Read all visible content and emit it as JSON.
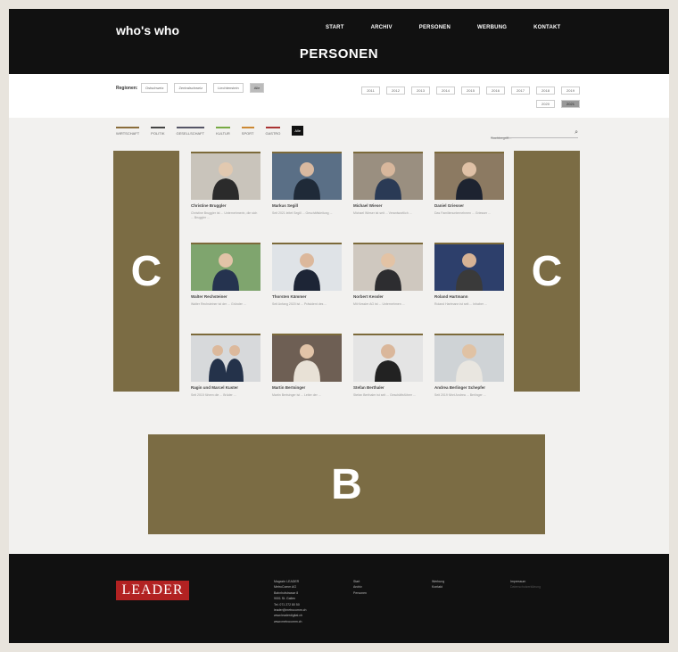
{
  "header": {
    "logo": "who's who",
    "nav": [
      "START",
      "ARCHIV",
      "PERSONEN",
      "WERBUNG",
      "KONTAKT"
    ],
    "page_title": "PERSONEN"
  },
  "filter": {
    "regions_label": "Regionen:",
    "regions": [
      "Ostschweiz",
      "Zentralschweiz",
      "Liechtenstein",
      "Alle"
    ],
    "years": [
      "2011",
      "2012",
      "2013",
      "2014",
      "2015",
      "2016",
      "2017",
      "2018",
      "2019",
      "2020",
      "2021"
    ]
  },
  "categories": [
    "WIRTSCHAFT",
    "POLITIK",
    "GESELLSCHAFT",
    "KULTUR",
    "SPORT",
    "GASTRO",
    "Alle"
  ],
  "search": {
    "placeholder": "Suchbegriff..."
  },
  "people": [
    {
      "name": "Christine Bruggler",
      "desc": "Christine Bruggler ist ... Unternehmerin, die sich ... Bruggler ..."
    },
    {
      "name": "Markus Segill",
      "desc": "Seit 2021 leitet Segill ... Geschäftsleitung ..."
    },
    {
      "name": "Michael Wieser",
      "desc": "Michael Wieser ist seit ... Verantwortlich ..."
    },
    {
      "name": "Daniel Griesser",
      "desc": "Das Familienunternehmen ... Griesser ..."
    },
    {
      "name": "Walter Rechsteiner",
      "desc": "Walter Rechsteiner ist der ... Gründer ..."
    },
    {
      "name": "Thorsten Kämmer",
      "desc": "Seit Anfang 2020 ist ... Präsident des ..."
    },
    {
      "name": "Norbert Kessler",
      "desc": "Mit Kessler AG ist ... Unternehmen ..."
    },
    {
      "name": "Roland Hartmann",
      "desc": "Roland Hartmann ist seit ... Inhaber ..."
    },
    {
      "name": "Ragin und Marcel Kuster",
      "desc": "Seit 2015 führen die ... Brüder ..."
    },
    {
      "name": "Martin Bertsinger",
      "desc": "Martin Bertsinger ist ... Leiter der ..."
    },
    {
      "name": "Stefan Berthaler",
      "desc": "Stefan Berthaler ist seit ... Geschäftsführer ..."
    },
    {
      "name": "Andrea Berlinger Schepfer",
      "desc": "Seit 2019 führt Andrea ... Berlinger ..."
    }
  ],
  "ads": {
    "left": "C",
    "right": "C",
    "bottom": "B"
  },
  "footer": {
    "logo": "LEADER",
    "col_a": [
      "Magazin LEADER",
      "MetroComm AG",
      "Bahnhofstrasse 8",
      "9001 St. Gallen",
      "Tel. 071 272 80 50",
      "leader@metrocomm.ch",
      "www.leaderdigital.ch",
      "www.metrocomm.ch"
    ],
    "col_b": [
      "Start",
      "Archiv",
      "Personen"
    ],
    "col_c": [
      "Werbung",
      "Kontakt"
    ],
    "col_d_title": "Impressum",
    "col_d_sub": "Datenschutzerklärung"
  },
  "colors": {
    "ad": "#7b6c44",
    "header": "#111111",
    "accent": "#7c6a3a"
  }
}
